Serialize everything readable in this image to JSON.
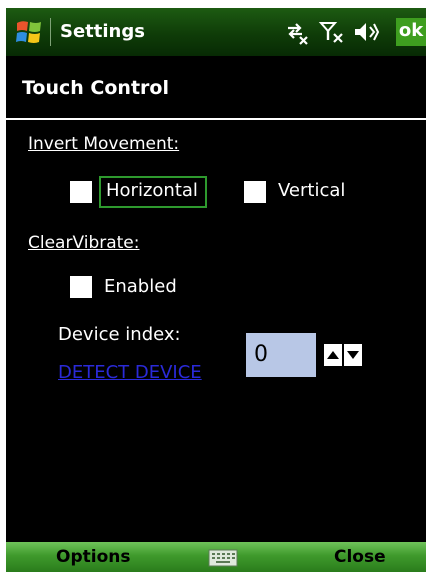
{
  "title_bar": {
    "title": "Settings",
    "ok_label": "ok",
    "icons": [
      "windows-logo",
      "connectivity-icon",
      "signal-off-icon",
      "speaker-icon"
    ]
  },
  "header": {
    "title": "Touch Control"
  },
  "invert_movement": {
    "label": "Invert Movement:",
    "horizontal_label": "Horizontal",
    "horizontal_checked": false,
    "vertical_label": "Vertical",
    "vertical_checked": false
  },
  "clear_vibrate": {
    "label": "ClearVibrate:",
    "enabled_label": "Enabled",
    "enabled_checked": false
  },
  "device": {
    "index_label": "Device index:",
    "detect_link": "DETECT DEVICE",
    "index_value": "0"
  },
  "softkeys": {
    "left": "Options",
    "right": "Close"
  },
  "colors": {
    "titlebar": "#0f3c08",
    "softbar": "#3f9a2c",
    "focus": "#2e9a2e",
    "link": "#2a2ad8",
    "spin_bg": "#b8c7e6"
  }
}
